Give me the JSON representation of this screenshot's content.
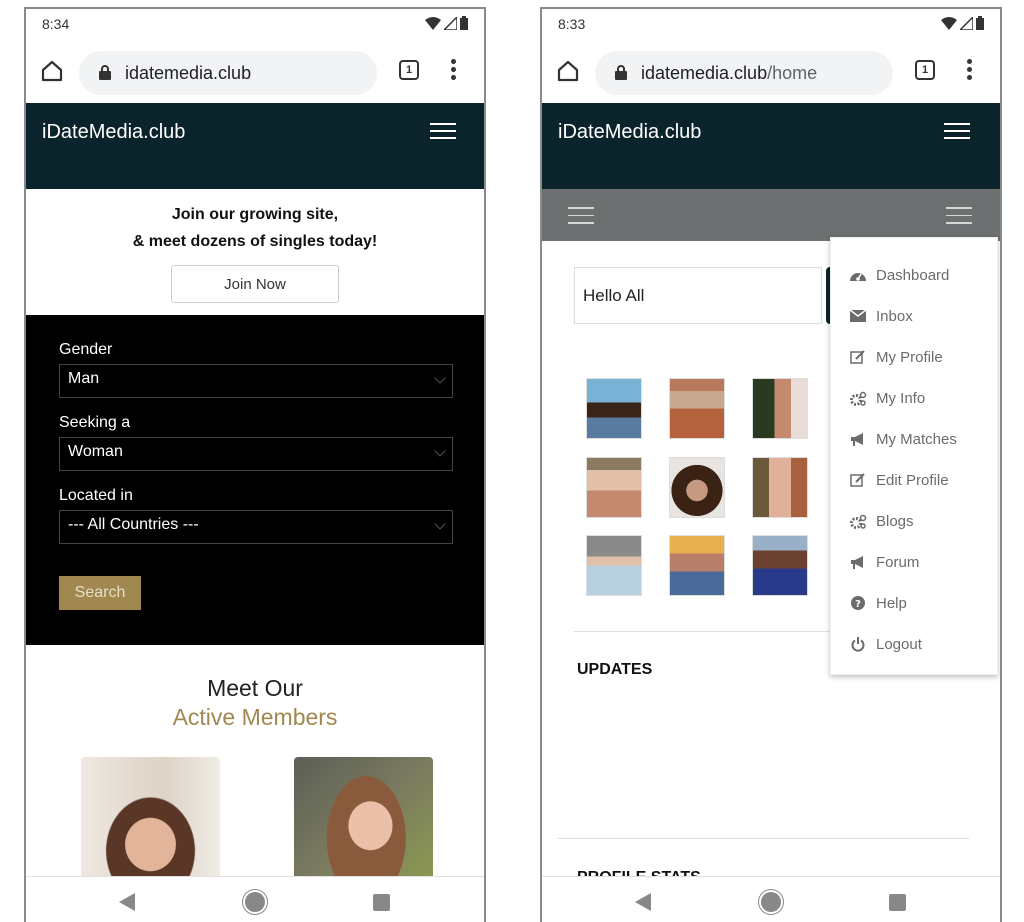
{
  "left_screen": {
    "status_bar": {
      "time": "8:34"
    },
    "browser": {
      "url_host": "idatemedia.club",
      "url_path": "",
      "tab_count": "1"
    },
    "header": {
      "brand": "iDateMedia.club"
    },
    "promo": {
      "line1": "Join our growing site,",
      "line2": "& meet dozens of singles today!",
      "join_button": "Join Now"
    },
    "search_form": {
      "gender_label": "Gender",
      "gender_value": "Man",
      "seeking_label": "Seeking a",
      "seeking_value": "Woman",
      "location_label": "Located in",
      "location_value": "--- All Countries ---",
      "search_button": "Search"
    },
    "members": {
      "title_line1": "Meet Our",
      "title_line2": "Active Members",
      "photos": [
        "member-photo-1",
        "member-photo-2"
      ]
    }
  },
  "right_screen": {
    "status_bar": {
      "time": "8:33"
    },
    "browser": {
      "url_host": "idatemedia.club",
      "url_path": "/home",
      "tab_count": "1"
    },
    "header": {
      "brand": "iDateMedia.club"
    },
    "status_input": {
      "value": "Hello All"
    },
    "photo_grid_count": 9,
    "sections": {
      "updates": "UPDATES",
      "profile_stats": "PROFILE STATS"
    },
    "menu": [
      {
        "label": "Dashboard",
        "icon": "dashboard-icon"
      },
      {
        "label": "Inbox",
        "icon": "envelope-icon"
      },
      {
        "label": "My Profile",
        "icon": "edit-icon"
      },
      {
        "label": "My Info",
        "icon": "gears-icon"
      },
      {
        "label": "My Matches",
        "icon": "megaphone-icon"
      },
      {
        "label": "Edit Profile",
        "icon": "edit-icon"
      },
      {
        "label": "Blogs",
        "icon": "gears-icon"
      },
      {
        "label": "Forum",
        "icon": "megaphone-icon"
      },
      {
        "label": "Help",
        "icon": "question-circle-icon"
      },
      {
        "label": "Logout",
        "icon": "power-icon"
      }
    ]
  },
  "colors": {
    "header_bg": "#0b242c",
    "accent_gold": "#a08850",
    "subnav_bg": "#6c7070",
    "menu_text": "#6b6b6b"
  }
}
